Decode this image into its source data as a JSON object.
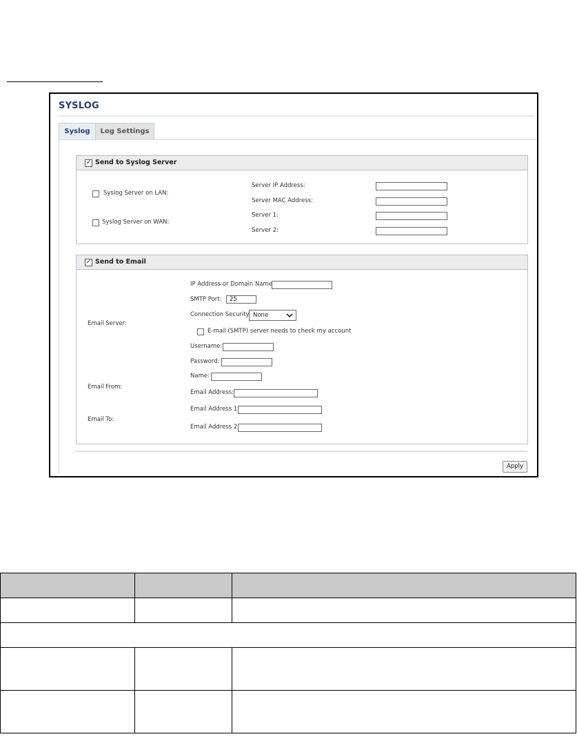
{
  "window": {
    "title": "SYSLOG",
    "tabs": [
      {
        "label": "Syslog",
        "active": true
      },
      {
        "label": "Log Settings",
        "active": false
      }
    ]
  },
  "syslog_section": {
    "header": "Send to Syslog Server",
    "header_checked": true,
    "lan_label": "Syslog Server on LAN:",
    "lan_checked": false,
    "wan_label": "Syslog Server on WAN:",
    "wan_checked": false,
    "fields": [
      {
        "label": "Server IP Address:",
        "value": ""
      },
      {
        "label": "Server MAC Address:",
        "value": ""
      },
      {
        "label": "Server 1:",
        "value": ""
      },
      {
        "label": "Server 2:",
        "value": ""
      }
    ]
  },
  "email_section": {
    "header": "Send to Email",
    "header_checked": true,
    "email_server_label": "Email Server:",
    "email_from_label": "Email From:",
    "email_to_label": "Email To:",
    "ip_domain_label": "IP Address or Domain Name:",
    "ip_domain_value": "",
    "smtp_port_label": "SMTP Port:",
    "smtp_port_value": "25",
    "connection_security_label": "Connection Security:",
    "connection_security_value": "None",
    "smtp_auth_label": "E-mail (SMTP) server needs to check my account",
    "smtp_auth_checked": false,
    "username_label": "Username:",
    "username_value": "",
    "password_label": "Password:",
    "password_value": "",
    "from_name_label": "Name:",
    "from_name_value": "",
    "from_address_label": "Email Address:",
    "from_address_value": "",
    "to_address1_label": "Email Address 1:",
    "to_address1_value": "",
    "to_address2_label": "Email Address 2:",
    "to_address2_value": ""
  },
  "apply_label": "Apply",
  "colors": {
    "title": "#1f3f73",
    "table_header": "#c9c9c9"
  }
}
